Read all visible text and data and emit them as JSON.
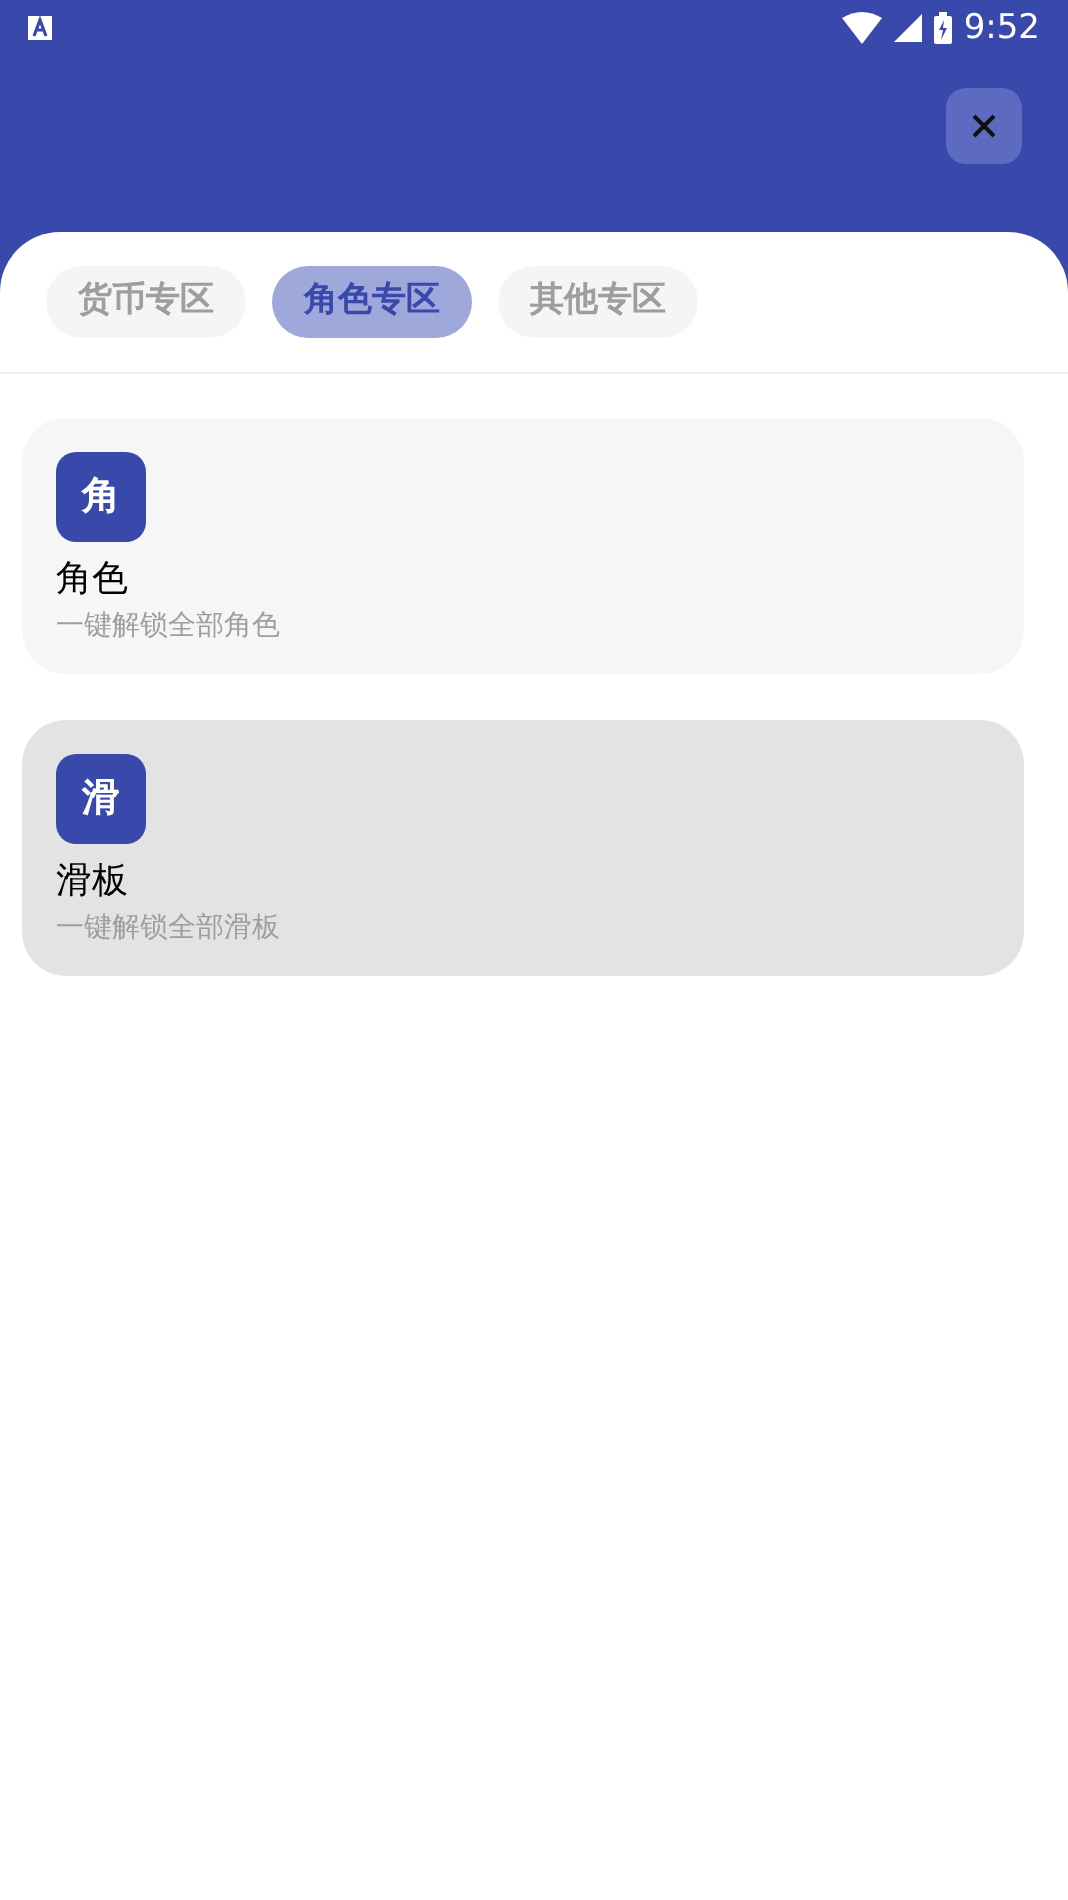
{
  "status_bar": {
    "time": "9:52"
  },
  "tabs": [
    {
      "label": "货币专区",
      "selected": false
    },
    {
      "label": "角色专区",
      "selected": true
    },
    {
      "label": "其他专区",
      "selected": false
    }
  ],
  "items": [
    {
      "icon_text": "角",
      "title": "角色",
      "subtitle": "一键解锁全部角色",
      "selected": false
    },
    {
      "icon_text": "滑",
      "title": "滑板",
      "subtitle": "一键解锁全部滑板",
      "selected": true
    }
  ]
}
